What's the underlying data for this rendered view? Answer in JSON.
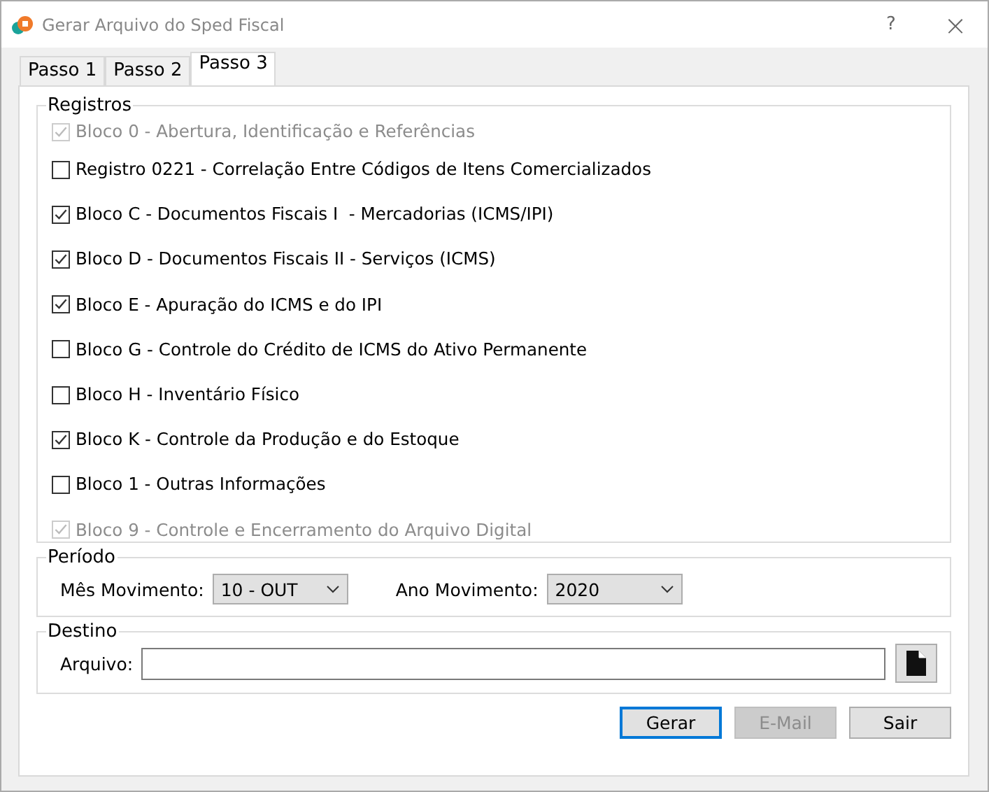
{
  "window": {
    "title": "Gerar Arquivo do Sped Fiscal",
    "help": "?",
    "close": "×"
  },
  "tabs": [
    {
      "label": "Passo 1",
      "selected": false
    },
    {
      "label": "Passo 2",
      "selected": false
    },
    {
      "label": "Passo 3",
      "selected": true
    }
  ],
  "registros": {
    "title": "Registros",
    "items": [
      {
        "label": "Bloco 0 - Abertura, Identificação e Referências",
        "checked": true,
        "disabled": true
      },
      {
        "label": "Registro 0221 - Correlação Entre Códigos de Itens Comercializados",
        "checked": false,
        "disabled": false
      },
      {
        "label": "Bloco C - Documentos Fiscais I  - Mercadorias (ICMS/IPI)",
        "checked": true,
        "disabled": false
      },
      {
        "label": "Bloco D - Documentos Fiscais II - Serviços (ICMS)",
        "checked": true,
        "disabled": false
      },
      {
        "label": "Bloco E - Apuração do ICMS e do IPI",
        "checked": true,
        "disabled": false
      },
      {
        "label": "Bloco G - Controle do Crédito de ICMS do Ativo Permanente",
        "checked": false,
        "disabled": false
      },
      {
        "label": "Bloco H - Inventário Físico",
        "checked": false,
        "disabled": false
      },
      {
        "label": "Bloco K - Controle da Produção e do Estoque",
        "checked": true,
        "disabled": false
      },
      {
        "label": "Bloco 1 - Outras Informações",
        "checked": false,
        "disabled": false
      },
      {
        "label": "Bloco 9 - Controle e Encerramento do Arquivo Digital",
        "checked": true,
        "disabled": true
      }
    ]
  },
  "periodo": {
    "title": "Período",
    "mes_label": "Mês Movimento:",
    "mes_value": "10 - OUT",
    "ano_label": "Ano Movimento:",
    "ano_value": "2020"
  },
  "destino": {
    "title": "Destino",
    "arquivo_label": "Arquivo:"
  },
  "buttons": [
    {
      "label": "Gerar",
      "default": true,
      "disabled": false
    },
    {
      "label": "E-Mail",
      "default": false,
      "disabled": true
    },
    {
      "label": "Sair",
      "default": false,
      "disabled": false
    }
  ]
}
